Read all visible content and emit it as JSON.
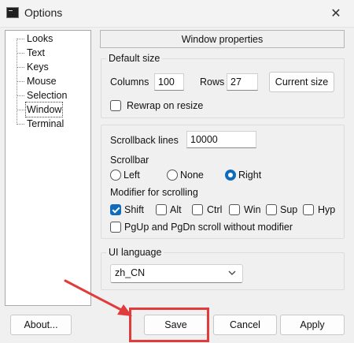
{
  "window": {
    "title": "Options",
    "close_glyph": "✕"
  },
  "tree": {
    "items": [
      {
        "label": "Looks"
      },
      {
        "label": "Text"
      },
      {
        "label": "Keys"
      },
      {
        "label": "Mouse"
      },
      {
        "label": "Selection"
      },
      {
        "label": "Window",
        "selected": true
      },
      {
        "label": "Terminal"
      }
    ]
  },
  "panel": {
    "title": "Window properties",
    "default_size": {
      "group_title": "Default size",
      "columns_label": "Columns",
      "columns_value": "100",
      "rows_label": "Rows",
      "rows_value": "27",
      "current_size_button": "Current size",
      "rewrap_label": "Rewrap on resize",
      "rewrap_checked": false
    },
    "scroll": {
      "scrollback_label": "Scrollback lines",
      "scrollback_value": "10000",
      "scrollbar_label": "Scrollbar",
      "scrollbar_options": [
        "Left",
        "None",
        "Right"
      ],
      "scrollbar_selected": "Right",
      "modifier_label": "Modifier for scrolling",
      "modifiers": [
        {
          "label": "Shift",
          "checked": true
        },
        {
          "label": "Alt",
          "checked": false
        },
        {
          "label": "Ctrl",
          "checked": false
        },
        {
          "label": "Win",
          "checked": false
        },
        {
          "label": "Sup",
          "checked": false
        },
        {
          "label": "Hyp",
          "checked": false
        }
      ],
      "pgup_label": "PgUp and PgDn scroll without modifier",
      "pgup_checked": false
    },
    "language": {
      "group_title": "UI language",
      "selected": "zh_CN"
    }
  },
  "footer": {
    "about_button": "About...",
    "save_button": "Save",
    "cancel_button": "Cancel",
    "apply_button": "Apply"
  },
  "colors": {
    "accent": "#0f6cbd",
    "annotation_red": "#e03c3c"
  }
}
